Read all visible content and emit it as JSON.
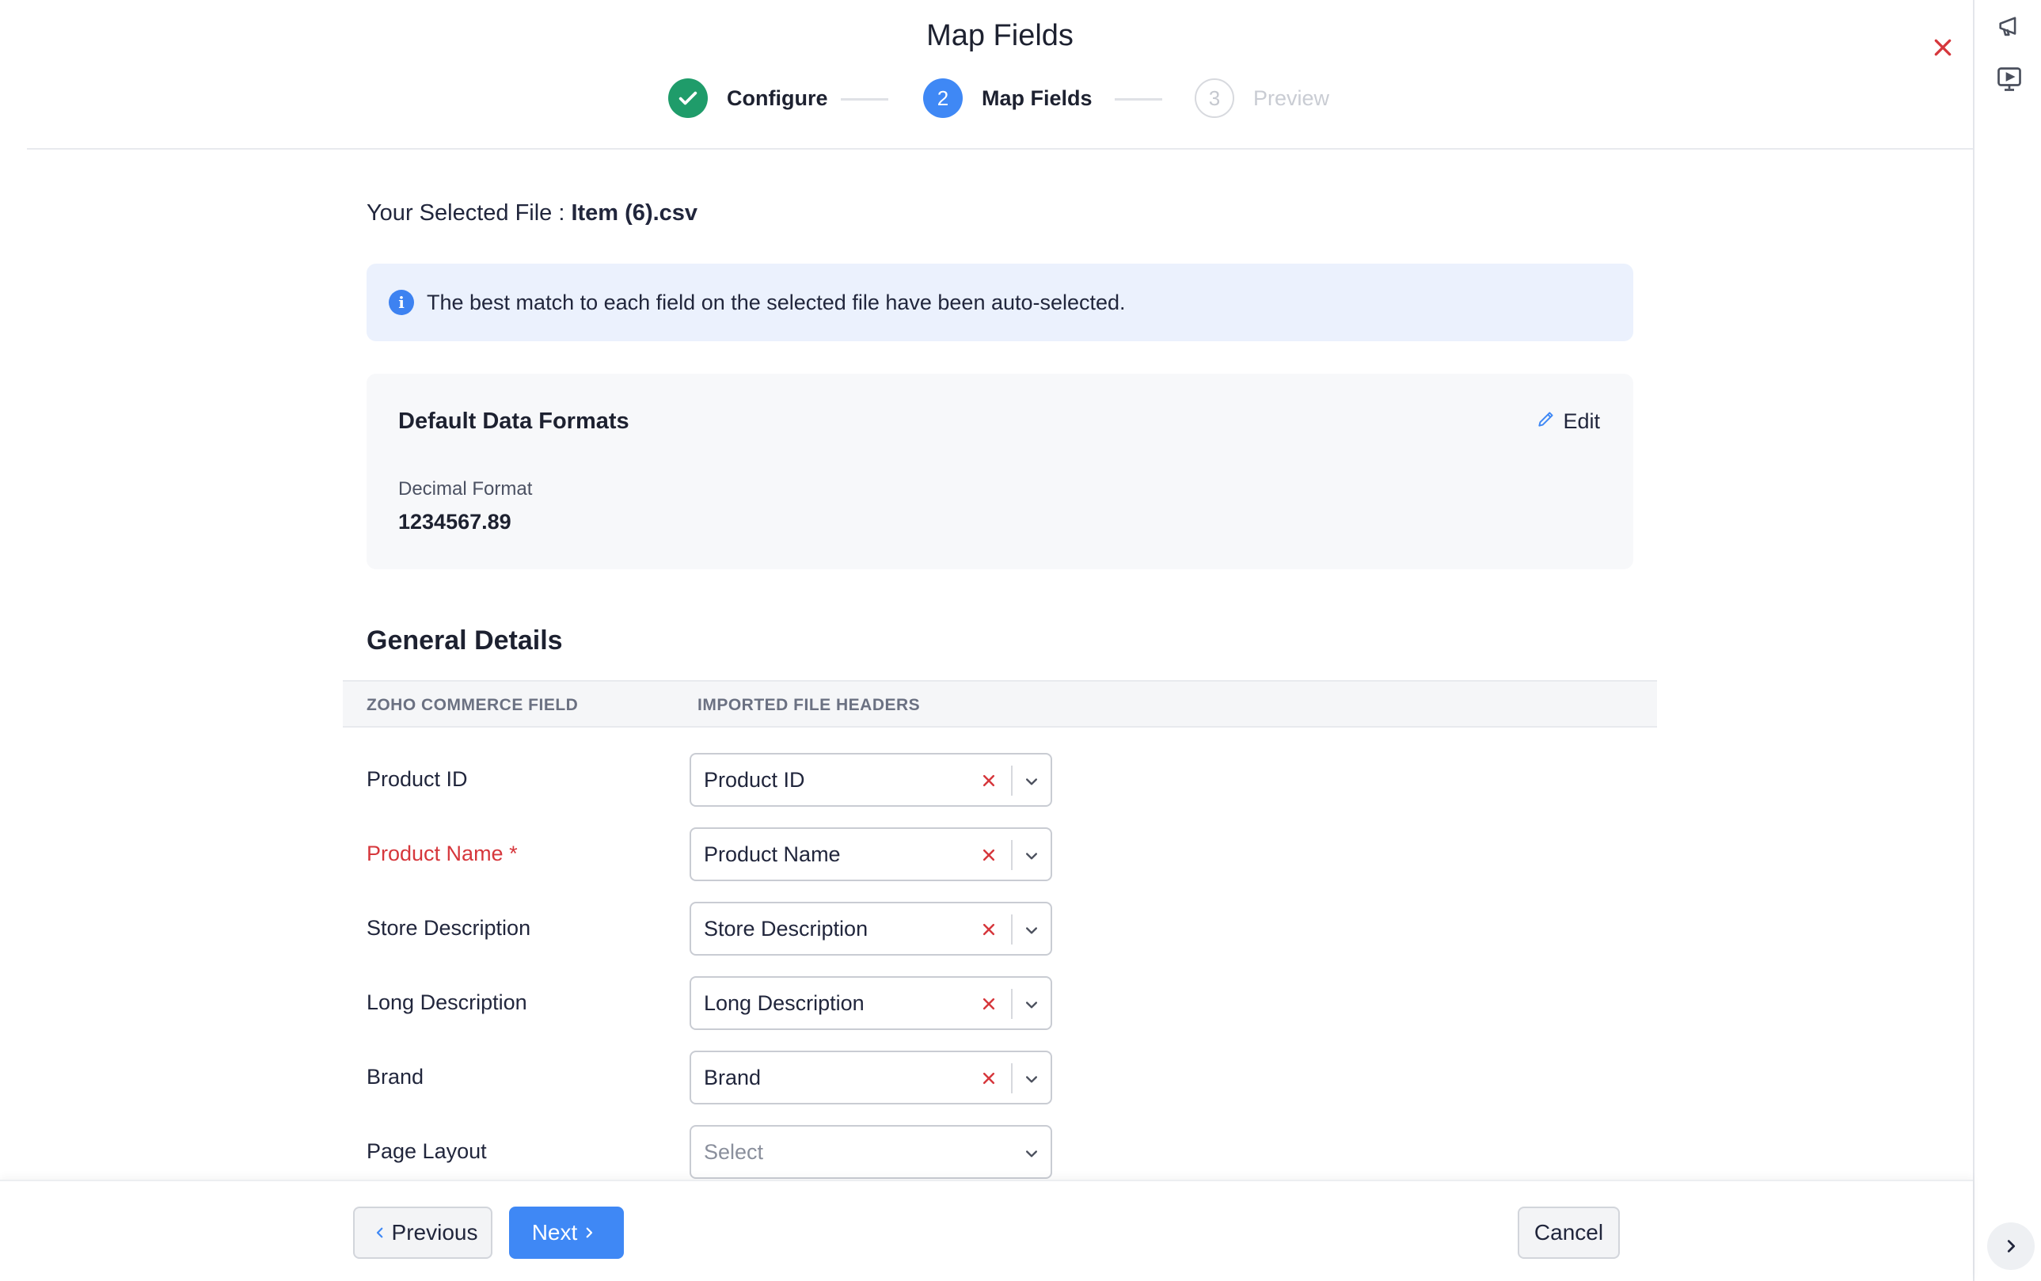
{
  "header": {
    "title": "Map Fields",
    "steps": [
      {
        "number": "",
        "label": "Configure",
        "state": "done"
      },
      {
        "number": "2",
        "label": "Map Fields",
        "state": "active"
      },
      {
        "number": "3",
        "label": "Preview",
        "state": "pending"
      }
    ]
  },
  "file": {
    "prefix": "Your Selected File : ",
    "name": "Item (6).csv"
  },
  "banner": {
    "text": "The best match to each field on the selected file have been auto-selected."
  },
  "formats": {
    "title": "Default Data Formats",
    "edit_label": "Edit",
    "decimal_label": "Decimal Format",
    "decimal_value": "1234567.89"
  },
  "general": {
    "title": "General Details",
    "col_field": "ZOHO COMMERCE FIELD",
    "col_header": "IMPORTED FILE HEADERS",
    "rows": [
      {
        "label": "Product ID",
        "value": "Product ID",
        "required": false
      },
      {
        "label": "Product Name *",
        "value": "Product Name",
        "required": true
      },
      {
        "label": "Store Description",
        "value": "Store Description",
        "required": false
      },
      {
        "label": "Long Description",
        "value": "Long Description",
        "required": false
      },
      {
        "label": "Brand",
        "value": "Brand",
        "required": false
      },
      {
        "label": "Page Layout",
        "value": "Select",
        "required": false
      }
    ]
  },
  "footer": {
    "previous_label": "Previous",
    "next_label": "Next",
    "cancel_label": "Cancel"
  },
  "colors": {
    "accent": "#3f88f5",
    "success": "#1f9c6a",
    "danger": "#d6373c"
  }
}
